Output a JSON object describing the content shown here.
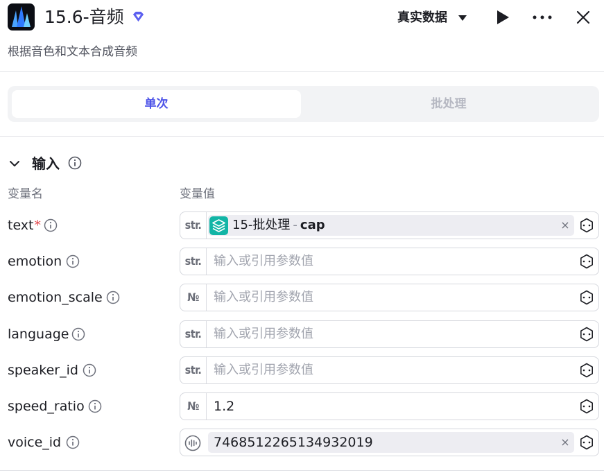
{
  "header": {
    "title": "15.6-音频",
    "data_mode": "真实数据",
    "logo": "app-logo",
    "icons": {
      "run": "play-icon",
      "more": "more-icon",
      "close": "close-icon",
      "badge": "gem-icon"
    }
  },
  "subtitle": "根据音色和文本合成音频",
  "tabs": [
    {
      "label": "单次",
      "active": true
    },
    {
      "label": "批处理",
      "active": false
    }
  ],
  "inputs_section": {
    "title": "输入",
    "col_name": "变量名",
    "col_value": "变量值",
    "rows": [
      {
        "name": "text",
        "required": "*",
        "type": "str.",
        "ref_node": "15-批处理",
        "ref_sep": "-",
        "ref_field": "cap"
      },
      {
        "name": "emotion",
        "type": "str.",
        "placeholder": "输入或引用参数值"
      },
      {
        "name": "emotion_scale",
        "type": "№",
        "placeholder": "输入或引用参数值"
      },
      {
        "name": "language",
        "type": "str.",
        "placeholder": "输入或引用参数值"
      },
      {
        "name": "speaker_id",
        "type": "str.",
        "placeholder": "输入或引用参数值"
      },
      {
        "name": "speed_ratio",
        "type": "№",
        "value": "1.2"
      },
      {
        "name": "voice_id",
        "type": "audio",
        "value": "7468512265134932019"
      }
    ],
    "clear_glyph": "×"
  },
  "colors": {
    "accent": "#4d53e8",
    "chip_icon": "#12b5a6",
    "required": "#e5484d"
  }
}
